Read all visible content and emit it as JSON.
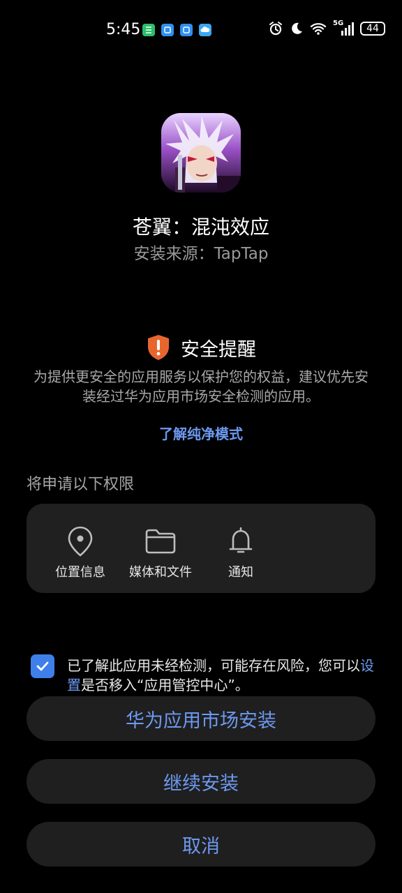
{
  "status_bar": {
    "time": "5:45",
    "signal_label": "5G",
    "battery": "44",
    "icons": [
      "alarm-icon",
      "moon-icon",
      "wifi-icon",
      "signal-icon",
      "battery-icon"
    ],
    "notification_icons": [
      "phone-notification-icon",
      "app-notification-icon",
      "app-notification-icon",
      "weather-notification-icon"
    ]
  },
  "app": {
    "name": "苍翼：混沌效应",
    "source": "安装来源：TapTap"
  },
  "security": {
    "title": "安全提醒",
    "description": "为提供更安全的应用服务以保护您的权益，建议优先安装经过华为应用市场安全检测的应用。",
    "learn_more": "了解纯净模式",
    "accent_color": "#e8662e"
  },
  "permissions": {
    "title": "将申请以下权限",
    "items": [
      {
        "label": "位置信息",
        "icon": "location-icon"
      },
      {
        "label": "媒体和文件",
        "icon": "folder-icon"
      },
      {
        "label": "通知",
        "icon": "bell-icon"
      }
    ]
  },
  "consent": {
    "checked": true,
    "text_before": "已了解此应用未经检测，可能存在风险，您可以",
    "link": "设置",
    "text_after": "是否移入“应用管控中心”。"
  },
  "buttons": {
    "market_install": "华为应用市场安装",
    "continue_install": "继续安装",
    "cancel": "取消"
  },
  "colors": {
    "link": "#6d99f0",
    "checkbox": "#3f7fea",
    "card": "#202020",
    "background": "#000000"
  }
}
